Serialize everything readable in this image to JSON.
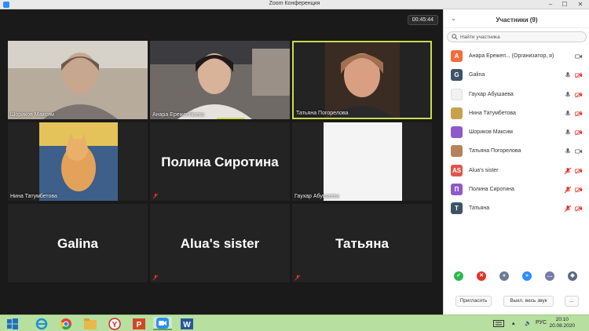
{
  "window": {
    "title": "Zoom Конференция"
  },
  "timer": "00:45:44",
  "tiles": [
    {
      "name": "Шориков Максим",
      "type": "video"
    },
    {
      "name": "Анара Ережепбаева",
      "type": "video"
    },
    {
      "name": "Татьяна Погорелова",
      "type": "video",
      "active": true
    },
    {
      "name": "Нина Татумбетова",
      "type": "video"
    },
    {
      "bigname": "Полина Сиротина",
      "type": "name"
    },
    {
      "name": "Гаухар Абушаева",
      "type": "video"
    },
    {
      "bigname": "Galina",
      "type": "name"
    },
    {
      "bigname": "Alua's sister",
      "type": "name"
    },
    {
      "bigname": "Татьяна",
      "type": "name"
    }
  ],
  "panel": {
    "title": "Участники (9)",
    "search_placeholder": "Найти участника",
    "participants": [
      {
        "initial": "А",
        "color": "#f26d3d",
        "name": "Анара Ережеп... (Организатор, я)"
      },
      {
        "initial": "G",
        "color": "#3e5366",
        "name": "Galina"
      },
      {
        "initial": "",
        "color": "#f2f2f2",
        "name": "Гаухар Абушаева"
      },
      {
        "initial": "",
        "color": "#c9a14a",
        "name": "Нина Татумбетова"
      },
      {
        "initial": "",
        "color": "#8e59c9",
        "name": "Шориков Максим"
      },
      {
        "initial": "",
        "color": "#b5835a",
        "name": "Татьяна Погорелова"
      },
      {
        "initial": "AS",
        "color": "#e2544b",
        "name": "Alua's sister"
      },
      {
        "initial": "П",
        "color": "#8e59c9",
        "name": "Полина Сиротина"
      },
      {
        "initial": "Т",
        "color": "#3e5366",
        "name": "Татьяна"
      }
    ],
    "invite_label": "Пригласить",
    "mute_all_label": "Выкл. весь звук",
    "more_label": "..."
  },
  "taskbar": {
    "lang": "РУС",
    "time": "20:10",
    "date": "20.08.2020"
  },
  "colors": {
    "accent": "#c9dd4a",
    "muted_red": "#e0322b",
    "taskbar": "#b6dfa0"
  }
}
